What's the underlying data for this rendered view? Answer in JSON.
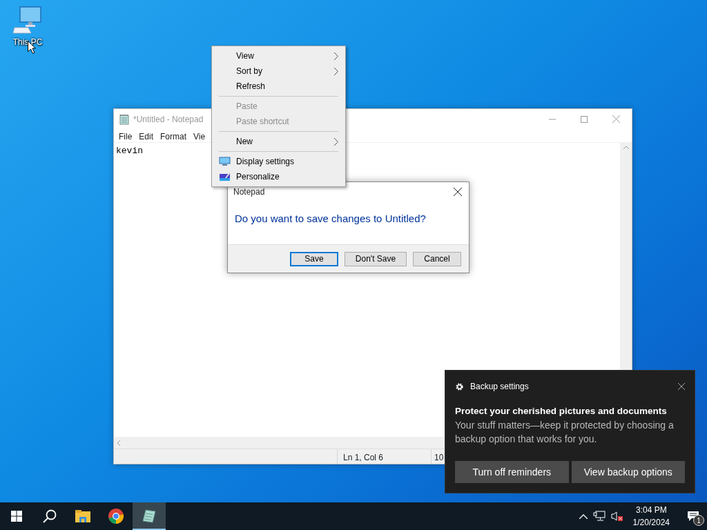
{
  "desktop_icons": [
    {
      "label": "This PC"
    }
  ],
  "notepad": {
    "title": "*Untitled - Notepad",
    "menu": [
      "File",
      "Edit",
      "Format",
      "Vie"
    ],
    "text": "kevin",
    "status": [
      "Ln 1, Col 6",
      "10"
    ]
  },
  "context_menu": {
    "items": [
      {
        "kind": "command",
        "label": "View",
        "submenu": true,
        "disabled": false
      },
      {
        "kind": "command",
        "label": "Sort by",
        "submenu": true,
        "disabled": false
      },
      {
        "kind": "command",
        "label": "Refresh",
        "submenu": false,
        "disabled": false
      },
      {
        "kind": "separator"
      },
      {
        "kind": "command",
        "label": "Paste",
        "submenu": false,
        "disabled": true
      },
      {
        "kind": "command",
        "label": "Paste shortcut",
        "submenu": false,
        "disabled": true
      },
      {
        "kind": "separator"
      },
      {
        "kind": "command",
        "label": "New",
        "submenu": true,
        "disabled": false
      },
      {
        "kind": "separator"
      },
      {
        "kind": "icon_command",
        "label": "Display settings",
        "submenu": false,
        "disabled": false
      },
      {
        "kind": "icon_command",
        "label": "Personalize",
        "submenu": false,
        "disabled": false
      }
    ]
  },
  "dialog": {
    "title": "Notepad",
    "message": "Do you want to save changes to Untitled?",
    "buttons": [
      {
        "label": "Save",
        "selected": true
      },
      {
        "label": "Don't Save",
        "selected": false
      },
      {
        "label": "Cancel",
        "selected": false
      }
    ]
  },
  "toast": {
    "app": "Backup settings",
    "heading": "Protect your cherished pictures and documents",
    "body": "Your stuff matters—keep it protected by choosing a backup option that works for you.",
    "buttons": [
      "Turn off reminders",
      "View backup options"
    ]
  },
  "taskbar": {
    "apps": [
      {
        "kind": "explorer",
        "selected": false
      },
      {
        "kind": "chrome",
        "selected": false
      },
      {
        "kind": "notepad",
        "selected": true
      }
    ],
    "time": "3:04 PM",
    "date": "1/20/2024",
    "notification_count": "1"
  }
}
